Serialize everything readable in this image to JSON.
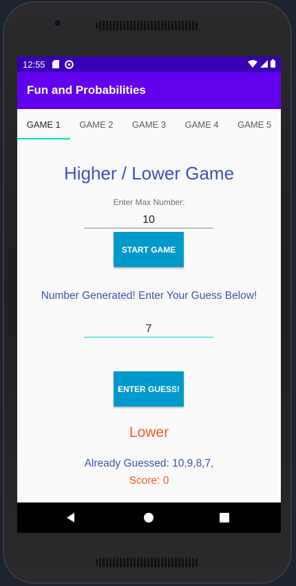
{
  "status_bar": {
    "time": "12:55",
    "icons": [
      "sd-card-icon",
      "sync-icon"
    ],
    "right_icons": [
      "wifi-icon",
      "signal-icon",
      "battery-icon"
    ]
  },
  "app_bar": {
    "title": "Fun and Probabilities"
  },
  "tabs": [
    {
      "label": "GAME 1",
      "active": true
    },
    {
      "label": "GAME 2",
      "active": false
    },
    {
      "label": "GAME 3",
      "active": false
    },
    {
      "label": "GAME 4",
      "active": false
    },
    {
      "label": "GAME 5",
      "active": false
    }
  ],
  "game": {
    "title": "Higher / Lower Game",
    "max_label": "Enter Max Number:",
    "max_value": "10",
    "start_button": "START GAME",
    "message": "Number Generated! Enter Your Guess Below!",
    "guess_value": "7",
    "enter_button": "ENTER GUESS!",
    "result": "Lower",
    "already_guessed": "Already Guessed: 10,9,8,7,",
    "score": "Score: 0"
  },
  "colors": {
    "status_bar": "#3700b3",
    "app_bar": "#6200ee",
    "accent": "#03dac5",
    "button": "#0099cc",
    "text_blue": "#3f51b5",
    "text_orange": "#ff5722"
  },
  "nav_bar": {
    "icons": [
      "back-icon",
      "home-icon",
      "recents-icon"
    ]
  }
}
